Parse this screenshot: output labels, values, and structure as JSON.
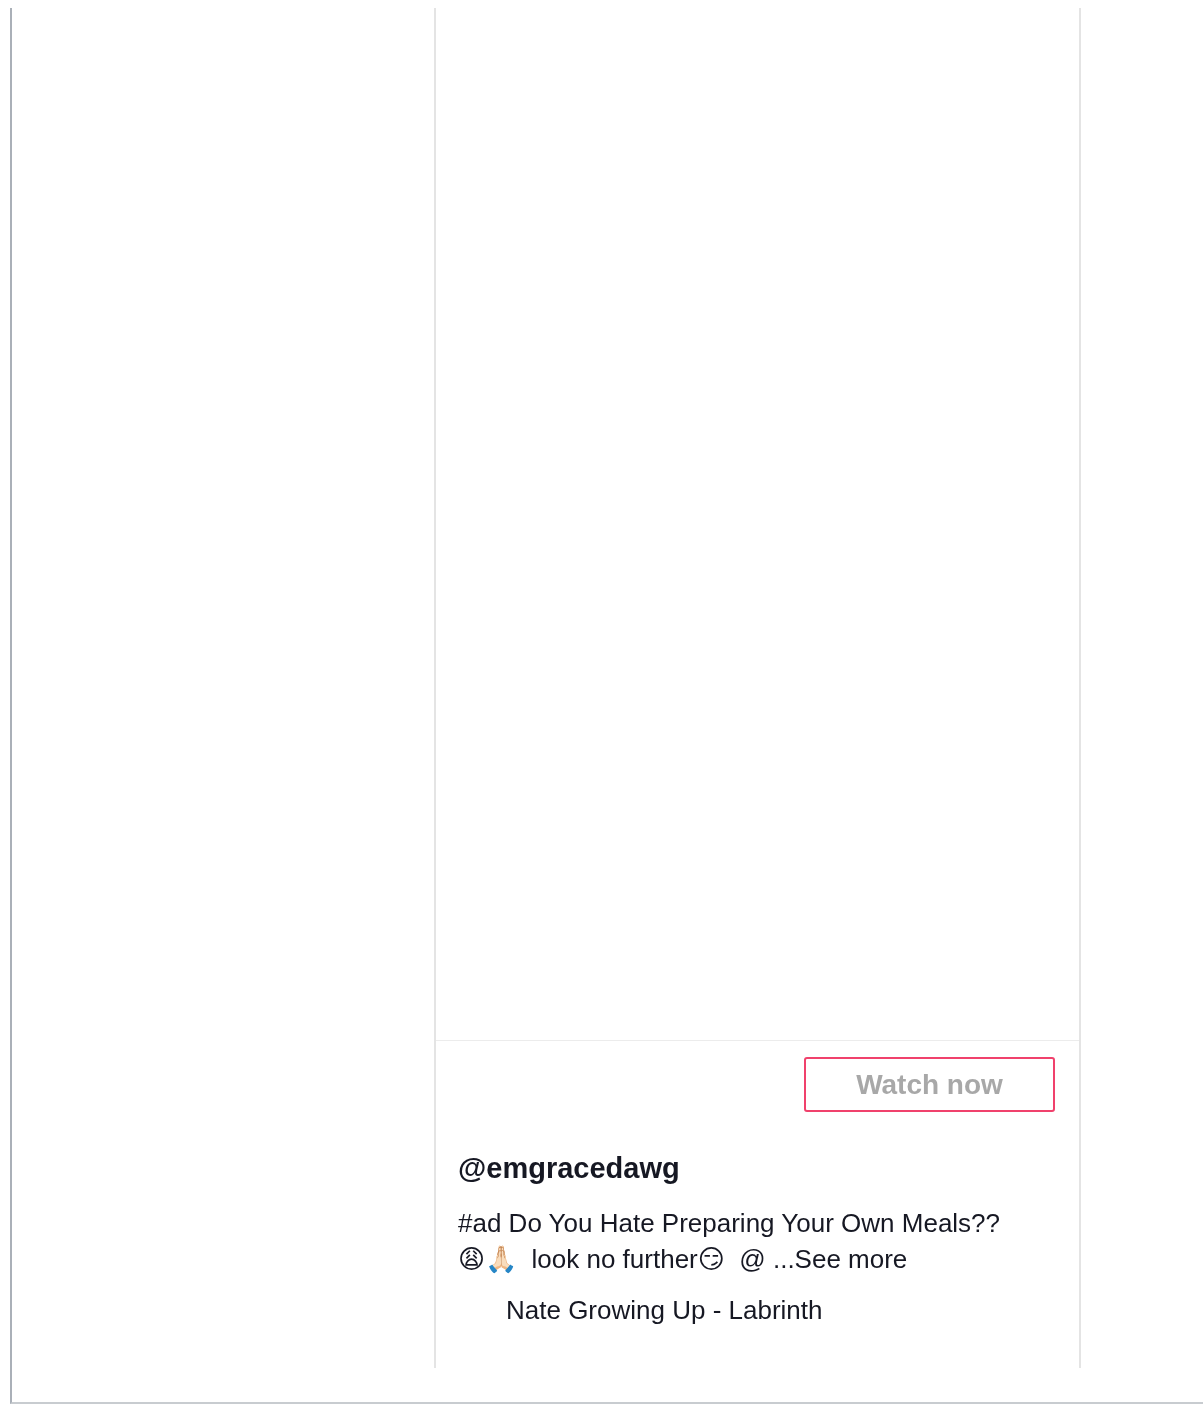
{
  "ad_card": {
    "button": "Watch now",
    "username": "@emgracedawg",
    "caption": "#ad Do You Hate Preparing Your Own Meals??😩🙏🏻  look no further😏  @ ...See more",
    "song": "Nate Growing Up - Labrinth"
  }
}
